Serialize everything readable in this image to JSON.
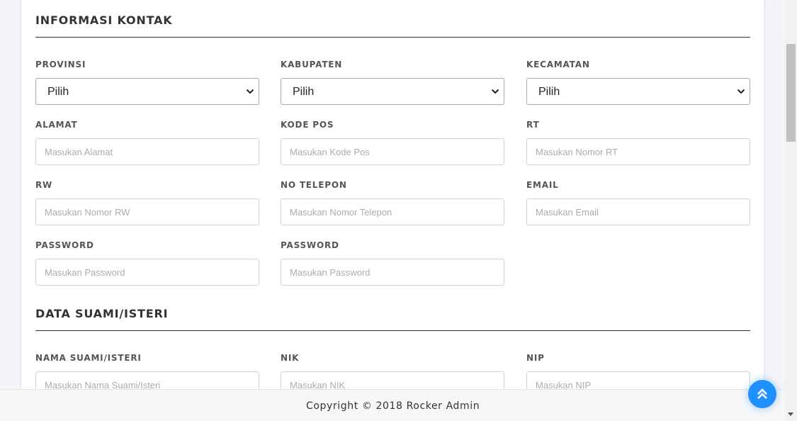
{
  "sections": {
    "contact": {
      "title": "INFORMASI KONTAK",
      "provinsi": {
        "label": "PROVINSI",
        "value": "Pilih"
      },
      "kabupaten": {
        "label": "KABUPATEN",
        "value": "Pilih"
      },
      "kecamatan": {
        "label": "KECAMATAN",
        "value": "Pilih"
      },
      "alamat": {
        "label": "ALAMAT",
        "placeholder": "Masukan Alamat"
      },
      "kode_pos": {
        "label": "KODE POS",
        "placeholder": "Masukan Kode Pos"
      },
      "rt": {
        "label": "RT",
        "placeholder": "Masukan Nomor RT"
      },
      "rw": {
        "label": "RW",
        "placeholder": "Masukan Nomor RW"
      },
      "no_telepon": {
        "label": "NO TELEPON",
        "placeholder": "Masukan Nomor Telepon"
      },
      "email": {
        "label": "EMAIL",
        "placeholder": "Masukan Email"
      },
      "password": {
        "label": "PASSWORD",
        "placeholder": "Masukan Password"
      },
      "password_confirm": {
        "label": "PASSWORD",
        "placeholder": "Masukan Password"
      }
    },
    "spouse": {
      "title": "DATA SUAMI/ISTERI",
      "nama": {
        "label": "NAMA SUAMI/ISTERI",
        "placeholder": "Masukan Nama Suami/Isteri"
      },
      "nik": {
        "label": "NIK",
        "placeholder": "Masukan NIK"
      },
      "nip": {
        "label": "NIP",
        "placeholder": "Masukan NIP"
      }
    }
  },
  "footer": {
    "copyright": "Copyright © 2018 Rocker Admin"
  },
  "icons": {
    "select_arrow": "chevron-down-icon",
    "back_to_top": "double-chevron-up-icon"
  },
  "colors": {
    "accent": "#1e90ff",
    "heading": "#333333",
    "label": "#555555",
    "border": "#cfd4da"
  }
}
